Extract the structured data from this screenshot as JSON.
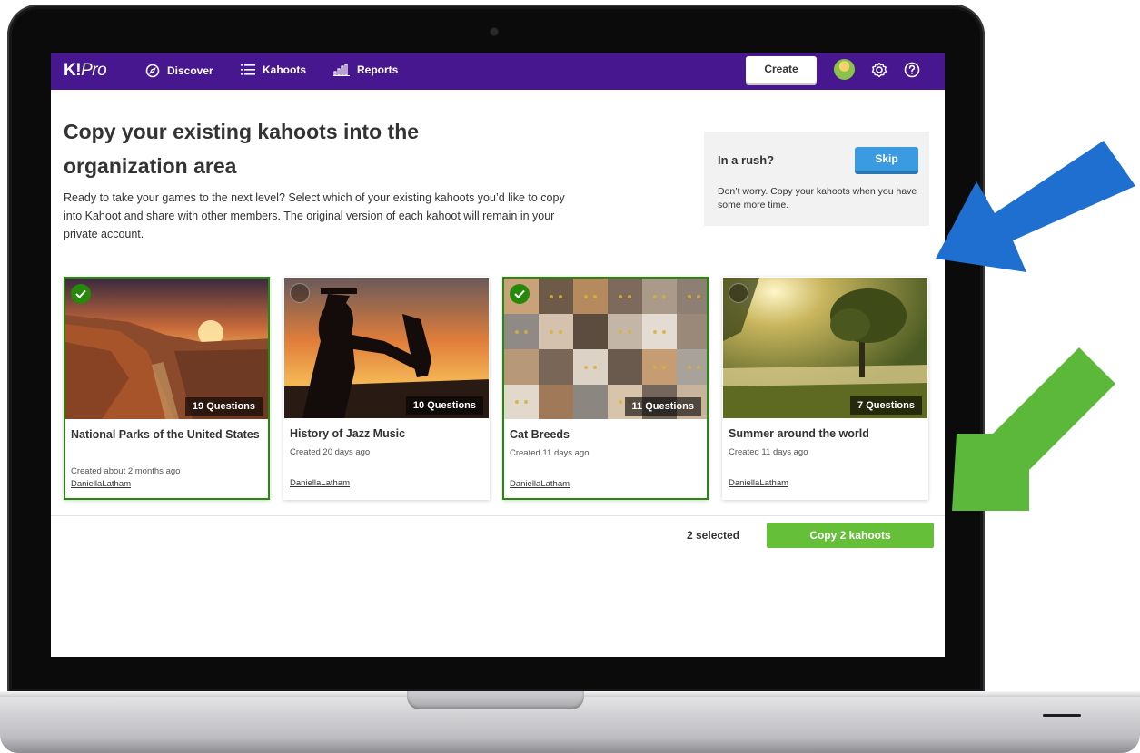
{
  "nav": {
    "logo_main": "K!",
    "logo_pro": "Pro",
    "discover": "Discover",
    "kahoots": "Kahoots",
    "reports": "Reports",
    "create": "Create"
  },
  "page": {
    "title": "Copy your existing kahoots into the organization area",
    "intro": "Ready to take your games to the next level? Select which of your existing kahoots you’d like to copy into Kahoot and share with other members. The original version of each kahoot will remain in your private account."
  },
  "rush": {
    "title": "In a rush?",
    "skip": "Skip",
    "text": "Don’t worry. Copy your kahoots when you have some more time."
  },
  "kahoots": [
    {
      "title": "National Parks of the United States",
      "questions": "19 Questions",
      "created": "Created about 2 months ago",
      "author": "DaniellaLatham",
      "selected": true,
      "image": "canyon-sunset"
    },
    {
      "title": "History of Jazz Music",
      "questions": "10 Questions",
      "created": "Created 20 days ago",
      "author": "DaniellaLatham",
      "selected": false,
      "image": "saxophone-silhouette"
    },
    {
      "title": "Cat Breeds",
      "questions": "11 Questions",
      "created": "Created 11 days ago",
      "author": "DaniellaLatham",
      "selected": true,
      "image": "cat-faces-grid"
    },
    {
      "title": "Summer around the world",
      "questions": "7 Questions",
      "created": "Created 11 days ago",
      "author": "DaniellaLatham",
      "selected": false,
      "image": "tree-lake-sunlight"
    }
  ],
  "footer": {
    "selected_count": "2 selected",
    "copy_button": "Copy 2 kahoots"
  },
  "colors": {
    "topbar": "#46178f",
    "selected_border": "#26890c",
    "skip": "#3a9be3",
    "copy": "#66bf39",
    "arrow_blue": "#1e6fd0",
    "arrow_green": "#5cb83a"
  }
}
